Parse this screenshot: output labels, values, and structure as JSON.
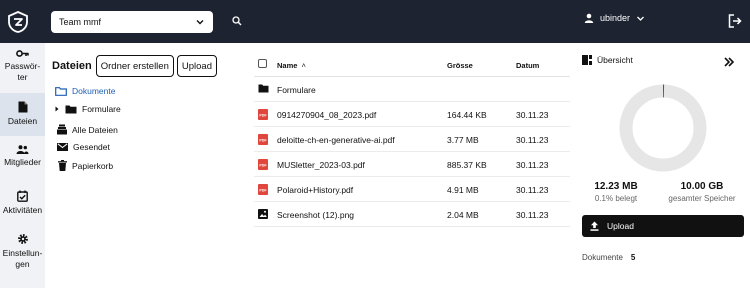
{
  "topbar": {
    "team": "Team mmf",
    "user": "ubinder"
  },
  "nav": [
    {
      "label": "Passwörter"
    },
    {
      "label": "Dateien"
    },
    {
      "label": "Mitglieder"
    },
    {
      "label": "Aktivitäten"
    },
    {
      "label": "Einstellungen"
    }
  ],
  "nav_labels": {
    "passwoerter_1": "Passwör-",
    "passwoerter_2": "ter",
    "dateien": "Dateien",
    "mitglieder": "Mitglieder",
    "aktivitaeten": "Aktivitäten",
    "einstellungen_1": "Einstellun-",
    "einstellungen_2": "gen"
  },
  "tree": {
    "title": "Dateien",
    "new_folder_button": "Ordner erstellen",
    "upload_button": "Upload",
    "documents": "Dokumente",
    "folder": "Formulare",
    "all_files": "Alle Dateien",
    "sent": "Gesendet",
    "trash": "Papierkorb"
  },
  "list": {
    "columns": {
      "name": "Name",
      "size": "Grösse",
      "date": "Datum"
    },
    "sort_indicator": "˄",
    "rows": [
      {
        "name": "Formulare",
        "size": "",
        "date": "",
        "type": "folder"
      },
      {
        "name": "0914270904_08_2023.pdf",
        "size": "164.44 KB",
        "date": "30.11.23",
        "type": "pdf"
      },
      {
        "name": "deloitte-ch-en-generative-ai.pdf",
        "size": "3.77 MB",
        "date": "30.11.23",
        "type": "pdf"
      },
      {
        "name": "MUSletter_2023-03.pdf",
        "size": "885.37 KB",
        "date": "30.11.23",
        "type": "pdf"
      },
      {
        "name": "Polaroid+History.pdf",
        "size": "4.91 MB",
        "date": "30.11.23",
        "type": "pdf"
      },
      {
        "name": "Screenshot (12).png",
        "size": "2.04 MB",
        "date": "30.11.23",
        "type": "image"
      }
    ]
  },
  "overview": {
    "title": "Übersicht",
    "used": "12.23 MB",
    "used_label": "0.1% belegt",
    "total": "10.00 GB",
    "total_label": "gesamter Speicher",
    "usage_fraction": 0.001,
    "upload_button": "Upload",
    "documents_label": "Dokumente",
    "documents_count": "5"
  },
  "colors": {
    "topbar": "#1d2330",
    "pdf_red": "#e0463c",
    "donut_track": "#e6e6e6",
    "accent_folder": "#1f5fb4"
  }
}
